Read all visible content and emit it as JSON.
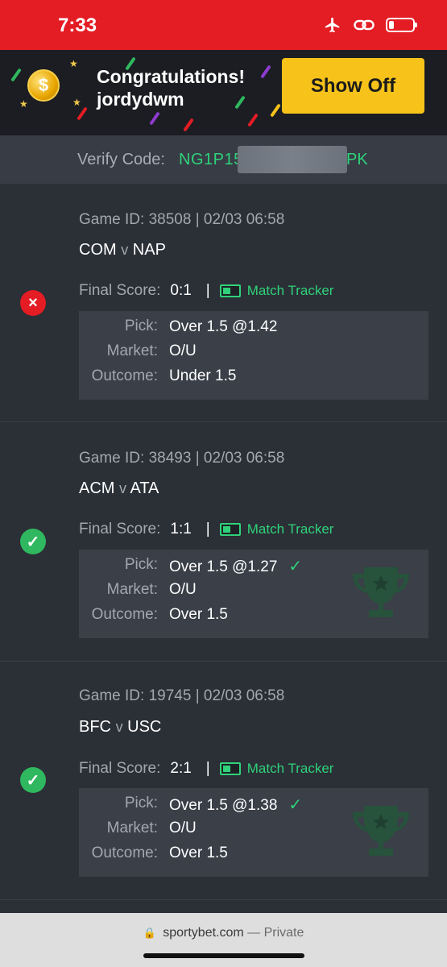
{
  "status_bar": {
    "time": "7:33"
  },
  "banner": {
    "title": "Congratulations!",
    "username": "jordydwm",
    "show_off_label": "Show Off",
    "coin_symbol": "$"
  },
  "verify": {
    "label": "Verify Code:",
    "code_start": "NG1P15",
    "code_end": "PK"
  },
  "bets": [
    {
      "game_id": "Game ID: 38508 | 02/03 06:58",
      "home": "COM",
      "vs": "v",
      "away": "NAP",
      "final_score_label": "Final Score:",
      "score": "0:1",
      "tracker": "Match Tracker",
      "status": "lost",
      "status_icon": "×",
      "pick_label": "Pick:",
      "pick": "Over 1.5 @1.42",
      "market_label": "Market:",
      "market": "O/U",
      "outcome_label": "Outcome:",
      "outcome": "Under 1.5",
      "pick_check": ""
    },
    {
      "game_id": "Game ID: 38493 | 02/03 06:58",
      "home": "ACM",
      "vs": "v",
      "away": "ATA",
      "final_score_label": "Final Score:",
      "score": "1:1",
      "tracker": "Match Tracker",
      "status": "won",
      "status_icon": "✓",
      "pick_label": "Pick:",
      "pick": "Over 1.5 @1.27",
      "market_label": "Market:",
      "market": "O/U",
      "outcome_label": "Outcome:",
      "outcome": "Over 1.5",
      "pick_check": "✓"
    },
    {
      "game_id": "Game ID: 19745 | 02/03 06:58",
      "home": "BFC",
      "vs": "v",
      "away": "USC",
      "final_score_label": "Final Score:",
      "score": "2:1",
      "tracker": "Match Tracker",
      "status": "won",
      "status_icon": "✓",
      "pick_label": "Pick:",
      "pick": "Over 1.5 @1.38",
      "market_label": "Market:",
      "market": "O/U",
      "outcome_label": "Outcome:",
      "outcome": "Over 1.5",
      "pick_check": "✓"
    }
  ],
  "browser": {
    "domain": "sportybet.com",
    "mode": "— Private"
  },
  "colors": {
    "brand_red": "#e41c24",
    "accent_green": "#2fd27a",
    "button_yellow": "#f7c31a"
  }
}
